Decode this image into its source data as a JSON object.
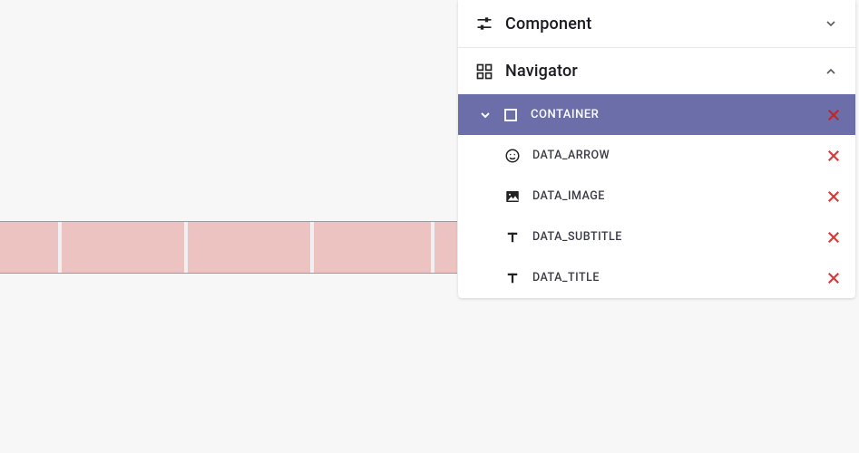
{
  "sections": {
    "component": {
      "label": "Component",
      "expanded": false
    },
    "navigator": {
      "label": "Navigator",
      "expanded": true
    }
  },
  "navigator_tree": {
    "root": {
      "label": "CONTAINER",
      "icon": "square",
      "expanded": true,
      "selected": true,
      "children": [
        {
          "label": "DATA_ARROW",
          "icon": "smile"
        },
        {
          "label": "DATA_IMAGE",
          "icon": "image"
        },
        {
          "label": "DATA_SUBTITLE",
          "icon": "text"
        },
        {
          "label": "DATA_TITLE",
          "icon": "text"
        }
      ]
    }
  },
  "colors": {
    "selection_bg": "#6b6ea8",
    "delete_icon": "#d83a3a",
    "canvas_strip": "#edc3c2"
  }
}
